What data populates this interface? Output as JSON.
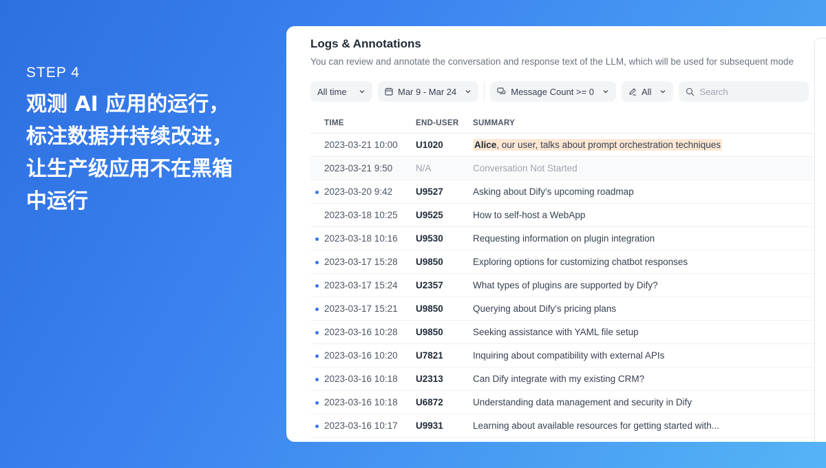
{
  "left": {
    "step": "STEP 4",
    "lines": [
      "观测 AI 应用的运行，",
      "标注数据并持续改进，",
      "让生产级应用不在黑箱",
      "中运行"
    ]
  },
  "panel": {
    "title": "Logs & Annotations",
    "subtitle": "You can review and annotate the conversation and response text of the LLM, which will be used for subsequent mode"
  },
  "filters": {
    "period": "All time",
    "date_range": "Mar 9 - Mar 24",
    "message_count": "Message Count >= 0",
    "annotation": "All",
    "search_placeholder": "Search"
  },
  "table": {
    "headers": {
      "time": "TIME",
      "user": "END-USER",
      "summary": "SUMMARY"
    },
    "rows": [
      {
        "time": "2023-03-21 10:00",
        "user": "U1020",
        "summary": "Alice, our user, talks about prompt orchestration techniques",
        "highlight_name": "Alice",
        "highlight_rest": ", our user, talks about prompt orchestration techniques",
        "dot": false
      },
      {
        "time": "2023-03-21 9:50",
        "user": "N/A",
        "summary": "Conversation Not Started",
        "dot": false,
        "muted": true
      },
      {
        "time": "2023-03-20 9:42",
        "user": "U9527",
        "summary": "Asking about Dify's upcoming roadmap",
        "dot": true
      },
      {
        "time": "2023-03-18 10:25",
        "user": "U9525",
        "summary": "How to self-host a WebApp",
        "dot": false
      },
      {
        "time": "2023-03-18 10:16",
        "user": "U9530",
        "summary": "Requesting information on plugin integration",
        "dot": true
      },
      {
        "time": "2023-03-17 15:28",
        "user": "U9850",
        "summary": "Exploring options for customizing chatbot responses",
        "dot": true
      },
      {
        "time": "2023-03-17 15:24",
        "user": "U2357",
        "summary": "What types of plugins are supported by Dify?",
        "dot": true
      },
      {
        "time": "2023-03-17 15:21",
        "user": "U9850",
        "summary": "Querying about Dify's pricing plans",
        "dot": true
      },
      {
        "time": "2023-03-16 10:28",
        "user": "U9850",
        "summary": "Seeking assistance with YAML file setup",
        "dot": true
      },
      {
        "time": "2023-03-16 10:20",
        "user": "U7821",
        "summary": "Inquiring about compatibility with external APIs",
        "dot": true
      },
      {
        "time": "2023-03-16 10:18",
        "user": "U2313",
        "summary": "Can Dify integrate with my existing CRM?",
        "dot": true
      },
      {
        "time": "2023-03-16 10:18",
        "user": "U6872",
        "summary": "Understanding data management and security in Dify",
        "dot": true
      },
      {
        "time": "2023-03-16 10:17",
        "user": "U9931",
        "summary": "Learning about available resources for getting started with...",
        "dot": true
      }
    ]
  },
  "colors": {
    "accent": "#3b74e8",
    "highlight": "#fde7d3"
  }
}
